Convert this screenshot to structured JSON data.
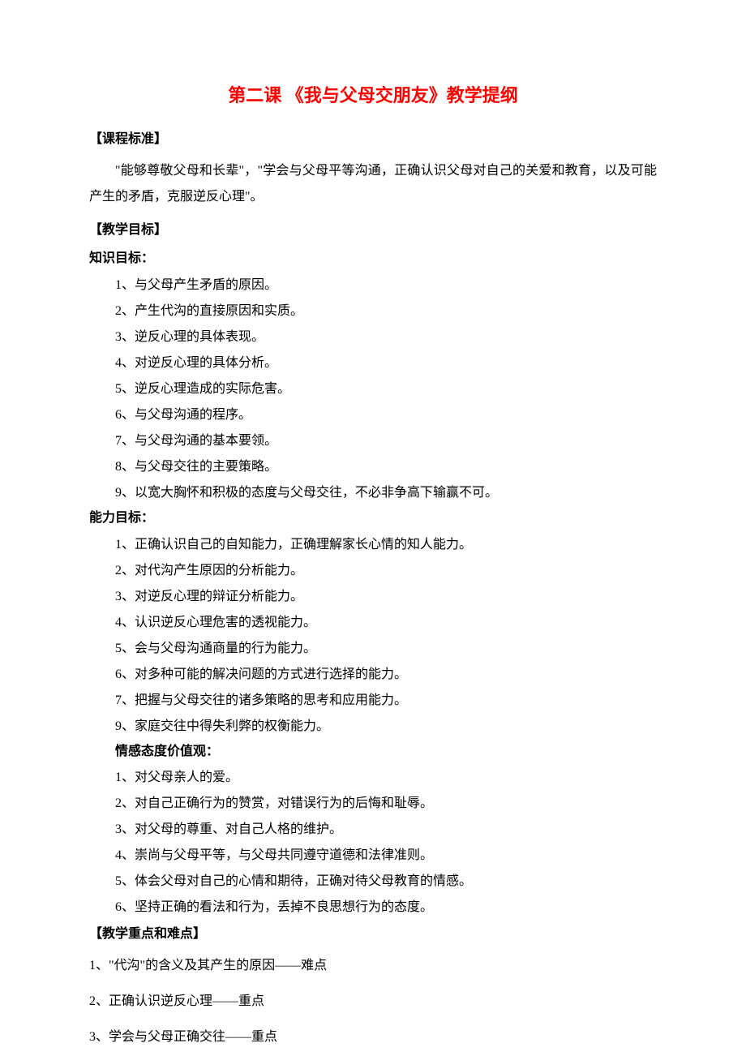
{
  "title": "第二课 《我与父母交朋友》教学提纲",
  "sections": {
    "standard": {
      "header": "【课程标准】",
      "content": "\"能够尊敬父母和长辈\"，\"学会与父母平等沟通，正确认识父母对自己的关爱和教育，以及可能产生的矛盾，克服逆反心理\"。"
    },
    "objectives": {
      "header": "【教学目标】",
      "knowledge": {
        "header": "知识目标：",
        "items": [
          "1、与父母产生矛盾的原因。",
          "2、产生代沟的直接原因和实质。",
          "3、逆反心理的具体表现。",
          "4、对逆反心理的具体分析。",
          "5、逆反心理造成的实际危害。",
          "6、与父母沟通的程序。",
          "7、与父母沟通的基本要领。",
          "8、与父母交往的主要策略。",
          "9、以宽大胸怀和积极的态度与父母交往，不必非争高下输赢不可。"
        ]
      },
      "ability": {
        "header": "能力目标：",
        "items": [
          "1、正确认识自己的自知能力，正确理解家长心情的知人能力。",
          "2、对代沟产生原因的分析能力。",
          "3、对逆反心理的辩证分析能力。",
          "4、认识逆反心理危害的透视能力。",
          "5、会与父母沟通商量的行为能力。",
          "6、对多种可能的解决问题的方式进行选择的能力。",
          "7、把握与父母交往的诸多策略的思考和应用能力。",
          "9、家庭交往中得失利弊的权衡能力。"
        ]
      },
      "emotion": {
        "header": "情感态度价值观：",
        "items": [
          "1、对父母亲人的爱。",
          "2、对自己正确行为的赞赏，对错误行为的后悔和耻辱。",
          "3、对父母的尊重、对自己人格的维护。",
          "4、崇尚与父母平等，与父母共同遵守道德和法律准则。",
          "5、体会父母对自己的心情和期待，正确对待父母教育的情感。",
          "6、坚持正确的看法和行为，丢掉不良思想行为的态度。"
        ]
      }
    },
    "focus": {
      "header": "【教学重点和难点】",
      "items": [
        "1、\"代沟\"的含义及其产生的原因——难点",
        "2、正确认识逆反心理——重点",
        "3、学会与父母正确交往——重点"
      ]
    }
  }
}
